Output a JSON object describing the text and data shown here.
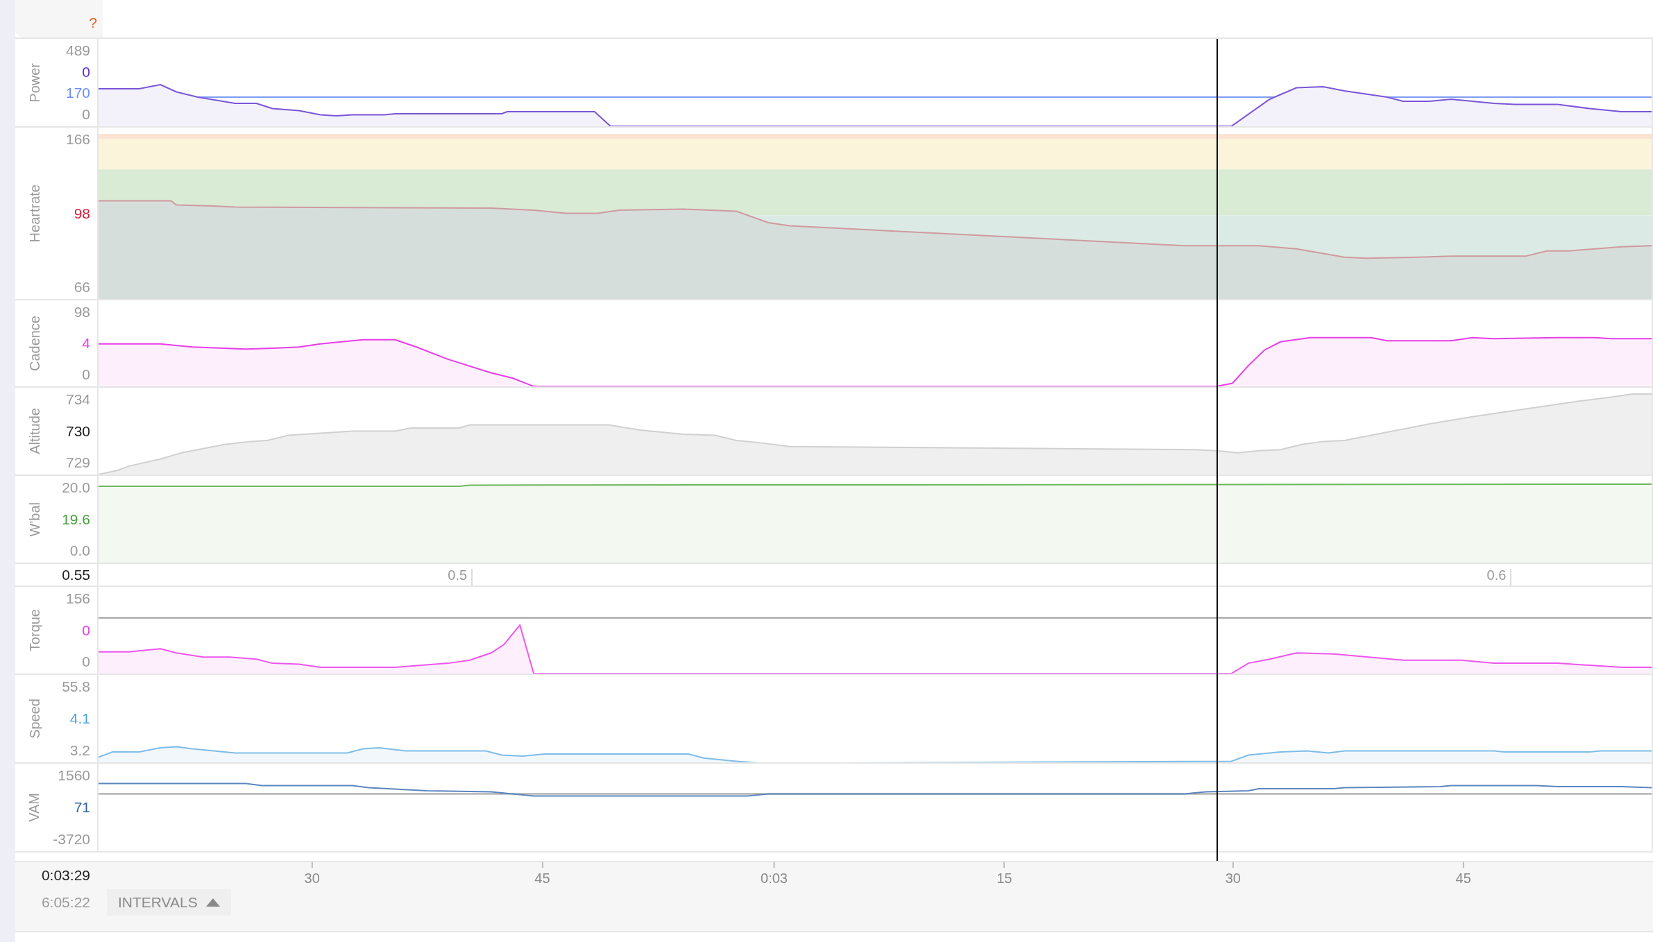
{
  "header": {
    "mark": "?"
  },
  "panels": [
    {
      "label": "Power",
      "kind": "power",
      "max": "489",
      "readings": [
        {
          "text": "0",
          "color": "#5a2fc8"
        },
        {
          "text": "170",
          "color": "#6b8ef5"
        }
      ],
      "min": "0"
    },
    {
      "label": "Heartrate",
      "kind": "heartrate",
      "max": "166",
      "readings": [
        {
          "text": "98",
          "color": "#d01f3c"
        }
      ],
      "min": "66"
    },
    {
      "label": "Cadence",
      "kind": "cadence",
      "max": "98",
      "readings": [
        {
          "text": "4",
          "color": "#e83de8"
        }
      ],
      "min": "0"
    },
    {
      "label": "Altitude",
      "kind": "altitude",
      "max": "734",
      "readings": [
        {
          "text": "730",
          "color": "#222222"
        }
      ],
      "min": "729"
    },
    {
      "label": "W'bal",
      "kind": "wbal",
      "max": "20.0",
      "readings": [
        {
          "text": "19.6",
          "color": "#47a03a"
        }
      ],
      "min": "0.0"
    },
    {
      "kind": "distance",
      "current": "0.55",
      "ticks": [
        "0.5",
        "0.6"
      ]
    },
    {
      "label": "Torque",
      "kind": "torque",
      "max": "156",
      "readings": [
        {
          "text": "0",
          "color": "#e83de8"
        }
      ],
      "min": "0"
    },
    {
      "label": "Speed",
      "kind": "speed",
      "max": "55.8",
      "readings": [
        {
          "text": "4.1",
          "color": "#4aa3e0"
        }
      ],
      "min": "3.2"
    },
    {
      "label": "VAM",
      "kind": "vam",
      "max": "1560",
      "readings": [
        {
          "text": "71",
          "color": "#2f63a8"
        }
      ],
      "min": "-3720"
    }
  ],
  "footer": {
    "time": "0:03:29",
    "ticks": [
      "30",
      "45",
      "0:03",
      "15",
      "30",
      "45"
    ],
    "total": "6:05:22",
    "intervals_button": "INTERVALS"
  }
}
